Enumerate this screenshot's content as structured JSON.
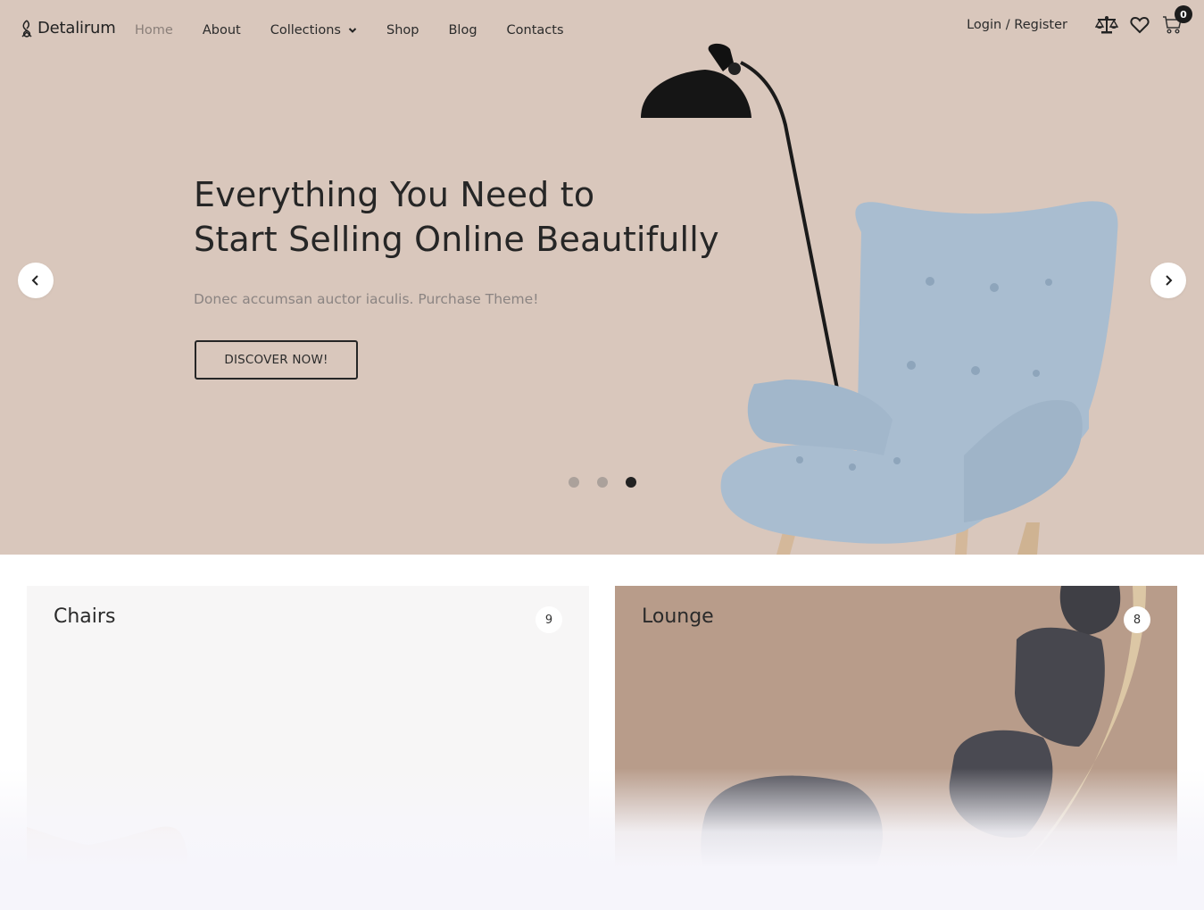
{
  "header": {
    "logo_text": "Detalirum",
    "nav": [
      {
        "label": "Home",
        "active": true
      },
      {
        "label": "About",
        "active": false
      },
      {
        "label": "Collections",
        "active": false,
        "has_dropdown": true
      },
      {
        "label": "Shop",
        "active": false
      },
      {
        "label": "Blog",
        "active": false
      },
      {
        "label": "Contacts",
        "active": false
      }
    ],
    "login_register": "Login / Register",
    "icons": [
      "compare-scale-icon",
      "heart-icon",
      "cart-icon"
    ],
    "cart_count": "0"
  },
  "hero": {
    "title_line1": "Everything You Need to",
    "title_line2": "Start Selling Online Beautifully",
    "subtitle": "Donec accumsan auctor iaculis. Purchase Theme!",
    "cta_label": "DISCOVER NOW!",
    "slides_total": 3,
    "active_slide": 3,
    "background_color": "#d9c7bc"
  },
  "categories": [
    {
      "name": "Chairs",
      "count": "9",
      "background_color": "#f7f6f6"
    },
    {
      "name": "Lounge",
      "count": "8",
      "background_color": "#b89c8a"
    }
  ]
}
